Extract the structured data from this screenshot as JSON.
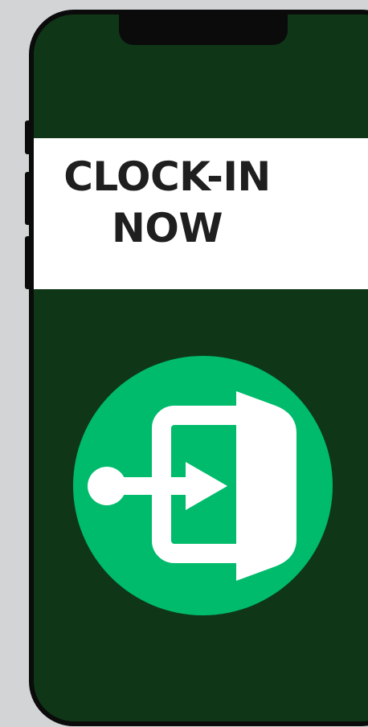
{
  "clock_in": {
    "line1": "CLOCK-IN",
    "line2": "NOW",
    "icon": "door-enter-icon",
    "accent_color": "#00bb6c",
    "screen_color": "#0f3717"
  }
}
